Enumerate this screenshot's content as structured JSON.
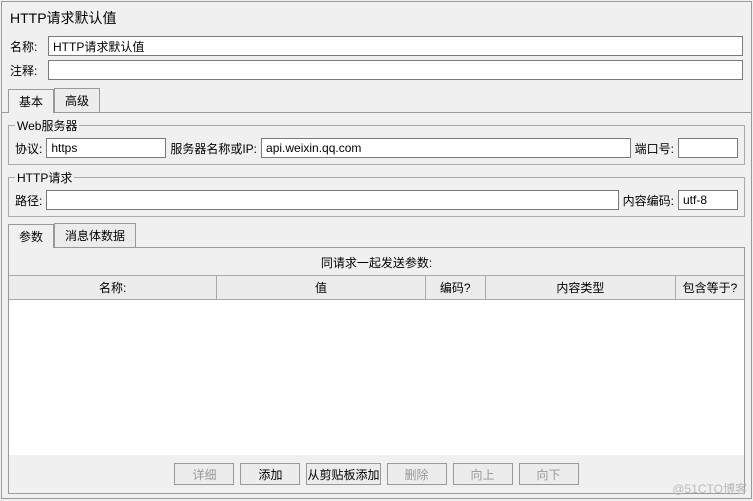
{
  "title": "HTTP请求默认值",
  "form": {
    "name_label": "名称:",
    "name_value": "HTTP请求默认值",
    "comment_label": "注释:",
    "comment_value": ""
  },
  "tabs": {
    "basic": "基本",
    "advanced": "高级"
  },
  "web_server": {
    "legend": "Web服务器",
    "protocol_label": "协议:",
    "protocol_value": "https",
    "server_label": "服务器名称或IP:",
    "server_value": "api.weixin.qq.com",
    "port_label": "端口号:",
    "port_value": ""
  },
  "http_request": {
    "legend": "HTTP请求",
    "path_label": "路径:",
    "path_value": "",
    "encoding_label": "内容编码:",
    "encoding_value": "utf-8"
  },
  "inner_tabs": {
    "params": "参数",
    "body": "消息体数据"
  },
  "params_table": {
    "title": "同请求一起发送参数:",
    "cols": {
      "name": "名称:",
      "value": "值",
      "encode": "编码?",
      "type": "内容类型",
      "equals": "包含等于?"
    }
  },
  "buttons": {
    "detail": "详细",
    "add": "添加",
    "clipboard": "从剪贴板添加",
    "delete": "删除",
    "up": "向上",
    "down": "向下"
  },
  "watermark": "@51CTO博客"
}
